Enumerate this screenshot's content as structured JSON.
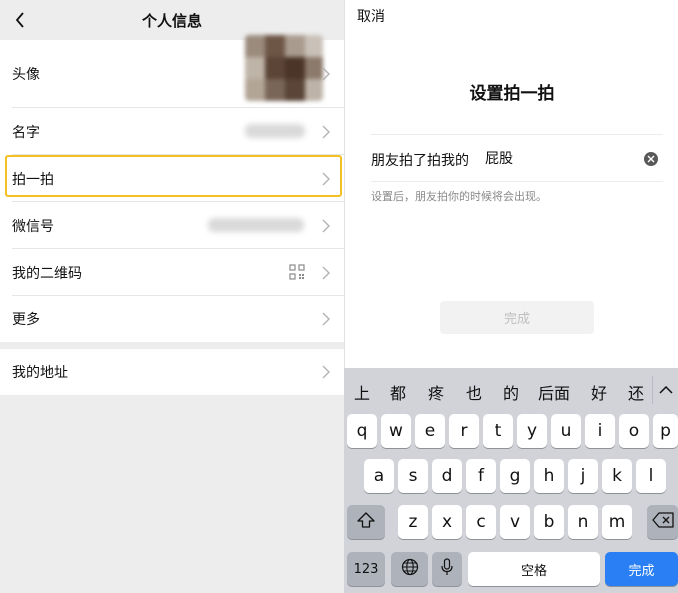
{
  "left": {
    "nav_title": "个人信息",
    "rows": [
      {
        "label": "头像"
      },
      {
        "label": "名字"
      },
      {
        "label": "拍一拍"
      },
      {
        "label": "微信号"
      },
      {
        "label": "我的二维码"
      },
      {
        "label": "更多"
      },
      {
        "label": "我的地址"
      }
    ]
  },
  "right": {
    "cancel": "取消",
    "title": "设置拍一拍",
    "prefix": "朋友拍了拍我的",
    "input_value": "屁股",
    "hint": "设置后，朋友拍你的时候将会出现。",
    "done": "完成"
  },
  "keyboard": {
    "candidates": [
      "上",
      "都",
      "疼",
      "也",
      "的",
      "后面",
      "好",
      "还"
    ],
    "row1": [
      "q",
      "w",
      "e",
      "r",
      "t",
      "y",
      "u",
      "i",
      "o",
      "p"
    ],
    "row2": [
      "a",
      "s",
      "d",
      "f",
      "g",
      "h",
      "j",
      "k",
      "l"
    ],
    "row3": [
      "z",
      "x",
      "c",
      "v",
      "b",
      "n",
      "m"
    ],
    "num_key": "123",
    "space": "空格",
    "return": "完成"
  },
  "colors": {
    "highlight": "#f5c024",
    "return_key": "#2a7ff4"
  }
}
